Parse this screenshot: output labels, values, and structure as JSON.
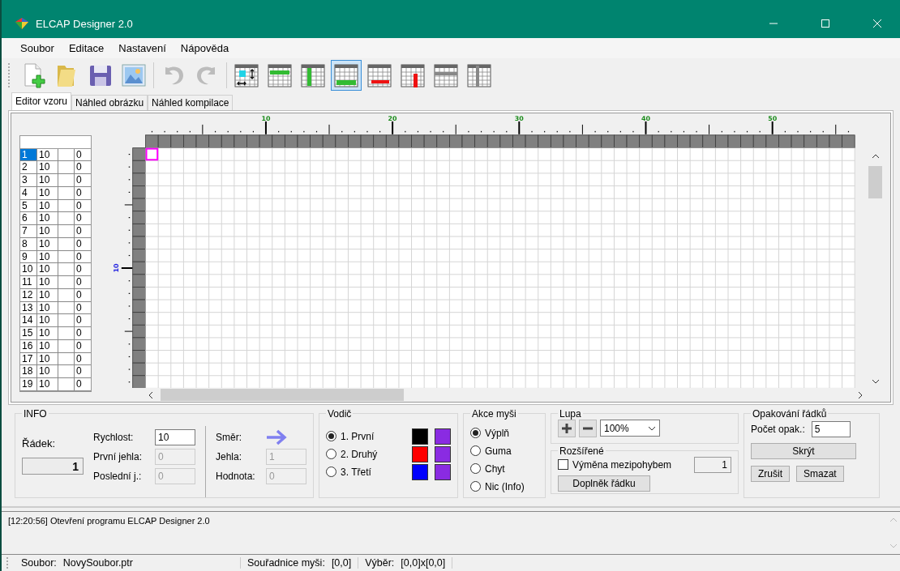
{
  "window": {
    "title": "ELCAP Designer 2.0"
  },
  "menu": [
    "Soubor",
    "Editace",
    "Nastavení",
    "Nápověda"
  ],
  "toolbar": [
    {
      "kind": "new",
      "disabled": false,
      "selected": false
    },
    {
      "kind": "open",
      "disabled": false,
      "selected": false
    },
    {
      "kind": "save",
      "disabled": false,
      "selected": false
    },
    {
      "kind": "image",
      "disabled": false,
      "selected": false
    },
    {
      "kind": "undo",
      "disabled": true,
      "selected": false
    },
    {
      "kind": "redo",
      "disabled": true,
      "selected": false
    },
    {
      "kind": "grid-cell",
      "disabled": false,
      "selected": false
    },
    {
      "kind": "top-row",
      "disabled": false,
      "selected": false
    },
    {
      "kind": "left-column",
      "disabled": false,
      "selected": false
    },
    {
      "kind": "bottom-row",
      "disabled": false,
      "selected": true
    },
    {
      "kind": "red-row",
      "disabled": false,
      "selected": false
    },
    {
      "kind": "red-column",
      "disabled": false,
      "selected": false
    },
    {
      "kind": "header-row",
      "disabled": false,
      "selected": false
    },
    {
      "kind": "header-column",
      "disabled": false,
      "selected": false
    }
  ],
  "tabs": [
    {
      "label": "Editor vzoru",
      "selected": true
    },
    {
      "label": "Náhled obrázku",
      "selected": false
    },
    {
      "label": "Náhled kompilace",
      "selected": false
    }
  ],
  "rows_table": {
    "rows": [
      {
        "column_1": "1",
        "column_2": "10",
        "column_4": "0",
        "selected": true
      },
      {
        "column_1": "2",
        "column_2": "10",
        "column_4": "0",
        "selected": false
      },
      {
        "column_1": "3",
        "column_2": "10",
        "column_4": "0",
        "selected": false
      },
      {
        "column_1": "4",
        "column_2": "10",
        "column_4": "0",
        "selected": false
      },
      {
        "column_1": "5",
        "column_2": "10",
        "column_4": "0",
        "selected": false
      },
      {
        "column_1": "6",
        "column_2": "10",
        "column_4": "0",
        "selected": false
      },
      {
        "column_1": "7",
        "column_2": "10",
        "column_4": "0",
        "selected": false
      },
      {
        "column_1": "8",
        "column_2": "10",
        "column_4": "0",
        "selected": false
      },
      {
        "column_1": "9",
        "column_2": "10",
        "column_4": "0",
        "selected": false
      },
      {
        "column_1": "10",
        "column_2": "10",
        "column_4": "0",
        "selected": false
      },
      {
        "column_1": "11",
        "column_2": "10",
        "column_4": "0",
        "selected": false
      },
      {
        "column_1": "12",
        "column_2": "10",
        "column_4": "0",
        "selected": false
      },
      {
        "column_1": "13",
        "column_2": "10",
        "column_4": "0",
        "selected": false
      },
      {
        "column_1": "14",
        "column_2": "10",
        "column_4": "0",
        "selected": false
      },
      {
        "column_1": "15",
        "column_2": "10",
        "column_4": "0",
        "selected": false
      },
      {
        "column_1": "16",
        "column_2": "10",
        "column_4": "0",
        "selected": false
      },
      {
        "column_1": "17",
        "column_2": "10",
        "column_4": "0",
        "selected": false
      },
      {
        "column_1": "18",
        "column_2": "10",
        "column_4": "0",
        "selected": false
      },
      {
        "column_1": "19",
        "column_2": "10",
        "column_4": "0",
        "selected": false
      }
    ]
  },
  "ruler": {
    "top_labels": [
      "10",
      "20",
      "30",
      "40",
      "50"
    ],
    "left_labels": [
      "10"
    ]
  },
  "info": {
    "title": "INFO",
    "row_label": "Řádek:",
    "row_value": "1",
    "fields": [
      {
        "label": "Rychlost:",
        "value": "10",
        "disabled": false
      },
      {
        "label": "První jehla:",
        "value": "0",
        "disabled": true
      },
      {
        "label": "Poslední j.:",
        "value": "0",
        "disabled": true
      }
    ],
    "direction_label": "Směr:",
    "right_fields": [
      {
        "label": "Jehla:",
        "value": "1",
        "disabled": true
      },
      {
        "label": "Hodnota:",
        "value": "0",
        "disabled": true
      }
    ]
  },
  "conductor": {
    "title": "Vodič",
    "options": [
      {
        "label": "1. První",
        "selected": true,
        "swatches": [
          {
            "color": "#000000"
          },
          {
            "color": "#8a2be2"
          }
        ]
      },
      {
        "label": "2. Druhý",
        "selected": false,
        "swatches": [
          {
            "color": "#ff0000"
          },
          {
            "color": "#8a2be2"
          }
        ]
      },
      {
        "label": "3. Třetí",
        "selected": false,
        "swatches": [
          {
            "color": "#0000ff"
          },
          {
            "color": "#8a2be2"
          }
        ]
      }
    ]
  },
  "mouse_action": {
    "title": "Akce myši",
    "options": [
      {
        "label": "Výplň",
        "selected": true
      },
      {
        "label": "Guma",
        "selected": false
      },
      {
        "label": "Chyt",
        "selected": false
      },
      {
        "label": "Nic (Info)",
        "selected": false
      }
    ]
  },
  "zoom": {
    "title": "Lupa",
    "value": "100%"
  },
  "extended": {
    "title": "Rozšířené",
    "checkbox": {
      "label": "Výměna mezipohybem",
      "checked": false
    },
    "value": "1",
    "button": "Doplněk řádku"
  },
  "repeat": {
    "title": "Opakování řádků",
    "count_label": "Počet opak.:",
    "count_value": "5",
    "buttons": [
      "Skrýt",
      "Zrušit",
      "Smazat"
    ]
  },
  "log": [
    "[12:20:56] Otevření programu ELCAP Designer 2.0"
  ],
  "status_bar": [
    {
      "label": "Soubor:",
      "value": "NovySoubor.ptr"
    },
    {
      "label": "Souřadnice myši:",
      "value": "[0,0]"
    },
    {
      "label": "Výběr:",
      "value": "[0,0]x[0,0]"
    }
  ]
}
